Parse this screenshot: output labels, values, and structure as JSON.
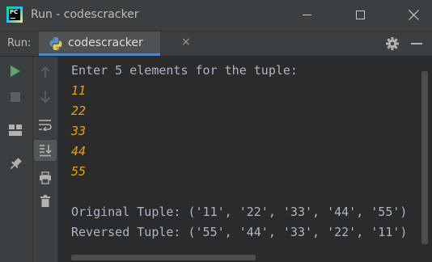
{
  "window": {
    "title": "Run - codescracker",
    "logo_text": "PC"
  },
  "run_panel": {
    "label": "Run:",
    "tab_label": "codescracker",
    "tab_close": "×"
  },
  "console": {
    "lines": [
      {
        "text": "Enter 5 elements for the tuple:",
        "kind": "output"
      },
      {
        "text": "11",
        "kind": "input"
      },
      {
        "text": "22",
        "kind": "input"
      },
      {
        "text": "33",
        "kind": "input"
      },
      {
        "text": "44",
        "kind": "input"
      },
      {
        "text": "55",
        "kind": "input"
      },
      {
        "text": "",
        "kind": "output"
      },
      {
        "text": "Original Tuple: ('11', '22', '33', '44', '55')",
        "kind": "output"
      },
      {
        "text": "Reversed Tuple: ('55', '44', '33', '22', '11')",
        "kind": "output"
      }
    ]
  },
  "icons": {
    "left_toolbar": [
      "run-icon",
      "stop-icon",
      "layout-icon",
      "pin-icon"
    ],
    "second_toolbar": [
      "scroll-up-icon",
      "scroll-down-icon",
      "soft-wrap-icon",
      "scroll-to-end-icon",
      "print-icon",
      "trash-icon"
    ],
    "top_right": [
      "gear-icon",
      "minimize-panel-icon"
    ]
  },
  "colors": {
    "background": "#2b2b2b",
    "toolbar": "#3c3f41",
    "output_text": "#a9b7c6",
    "input_text": "#e6a01e",
    "run_green": "#59a869",
    "tab_underline": "#4a88c7"
  }
}
